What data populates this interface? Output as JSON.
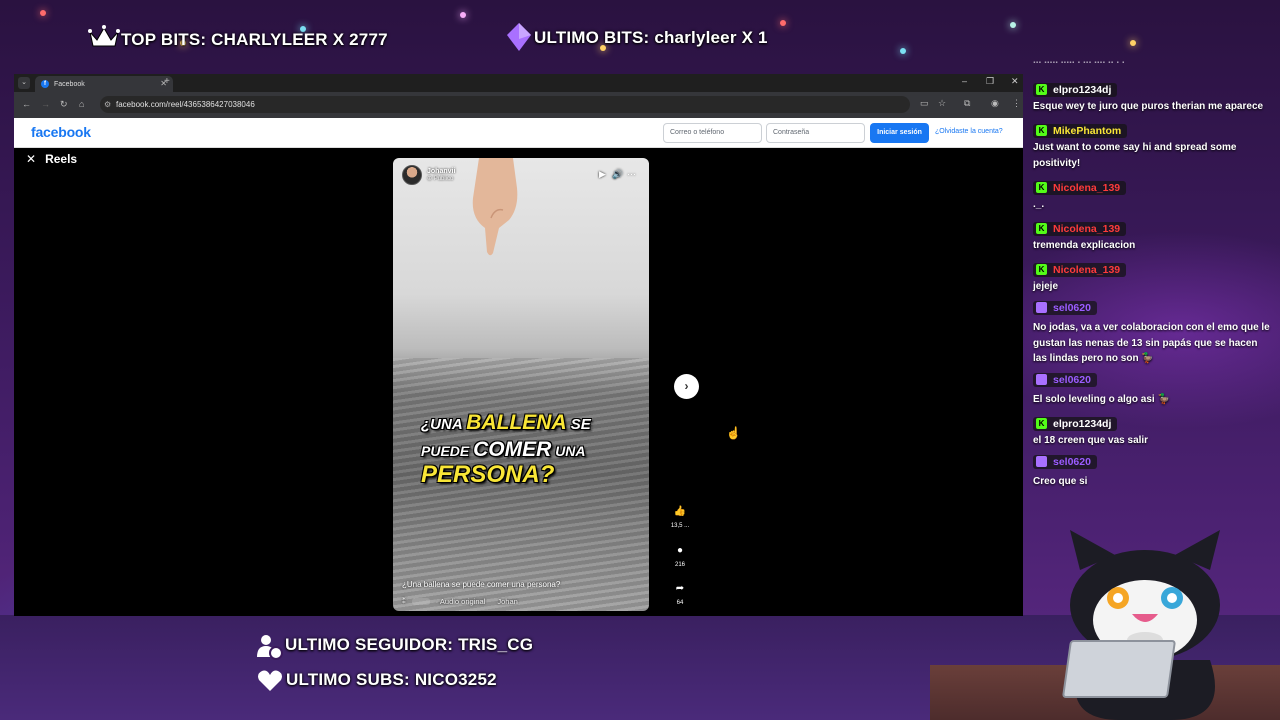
{
  "overlay": {
    "top_bits": "TOP BITS: CHARLYLEER X 2777",
    "ultimo_bits": "ULTIMO BITS: charlyleer X 1",
    "ultimo_seguidor": "ULTIMO SEGUIDOR: TRIS_CG",
    "ultimo_subs": "ULTIMO SUBS: NICO3252"
  },
  "browser": {
    "tab_title": "Facebook",
    "url": "facebook.com/reel/4365386427038046"
  },
  "facebook": {
    "logo": "facebook",
    "email_placeholder": "Correo o teléfono",
    "password_placeholder": "Contraseña",
    "login_button": "Iniciar sesión",
    "forgot_link": "¿Olvidaste la cuenta?"
  },
  "reels": {
    "header": "Reels",
    "author": "Johanvii",
    "visibility": "Público",
    "headline": {
      "line1_a": "¿UNA",
      "line1_b": "BALLENA",
      "line1_c": "SE",
      "line2_a": "PUEDE",
      "line2_b": "COMER",
      "line2_c": "UNA",
      "line3": "PERSONA?"
    },
    "caption": "¿Una ballena se puede comer una persona?",
    "audio_label": "· Audio original",
    "audio_artist": "Johan",
    "likes": "13,5 ...",
    "comments": "216",
    "shares": "64"
  },
  "chat": {
    "cut_line": "... ..... ..... . ... .... .. . .",
    "messages": [
      {
        "user": "elpro1234dj",
        "color": "#ffffff",
        "badge_color": "#53fc18",
        "badge": "K",
        "text": "Esque wey te juro que puros therian me aparece"
      },
      {
        "user": "MikePhantom",
        "color": "#f9e637",
        "badge_color": "#53fc18",
        "badge": "K",
        "text": "Just want to come say hi and spread some positivity!"
      },
      {
        "user": "Nicolena_139",
        "color": "#ff3b3b",
        "badge_color": "#53fc18",
        "badge": "K",
        "text": "._."
      },
      {
        "user": "Nicolena_139",
        "color": "#ff3b3b",
        "badge_color": "#53fc18",
        "badge": "K",
        "text": "tremenda explicacion"
      },
      {
        "user": "Nicolena_139",
        "color": "#ff3b3b",
        "badge_color": "#53fc18",
        "badge": "K",
        "text": "jejeje"
      },
      {
        "user": "sel0620",
        "color": "#9b5cff",
        "badge_color": "#a970ff",
        "badge": "",
        "text": "No jodas, va a ver colaboracion con el emo que le gustan las nenas de 13 sin papás que se hacen las lindas pero no son 🦆"
      },
      {
        "user": "sel0620",
        "color": "#9b5cff",
        "badge_color": "#a970ff",
        "badge": "",
        "text": "El solo leveling o algo asi 🦆"
      },
      {
        "user": "elpro1234dj",
        "color": "#ffffff",
        "badge_color": "#53fc18",
        "badge": "K",
        "text": "el 18 creen que vas salir"
      },
      {
        "user": "sel0620",
        "color": "#9b5cff",
        "badge_color": "#a970ff",
        "badge": "",
        "text": "Creo que si"
      }
    ]
  },
  "colors": {
    "facebook_blue": "#1877f2",
    "headline_yellow": "#f9e637",
    "kick_green": "#53fc18",
    "twitch_purple": "#a970ff"
  }
}
